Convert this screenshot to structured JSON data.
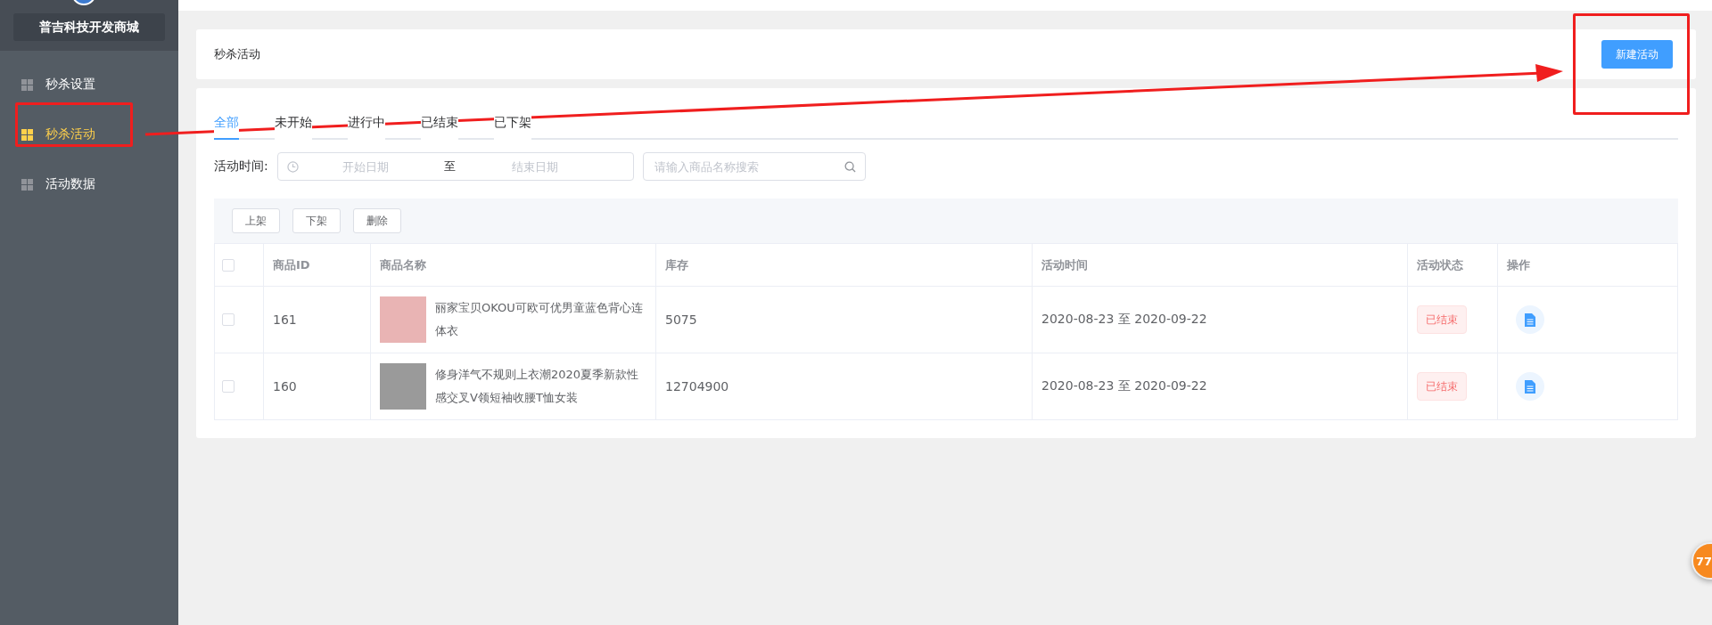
{
  "sidebar": {
    "store_name": "普吉科技开发商城",
    "items": [
      {
        "label": "秒杀设置",
        "selected": false
      },
      {
        "label": "秒杀活动",
        "selected": true
      },
      {
        "label": "活动数据",
        "selected": false
      }
    ]
  },
  "header": {
    "title": "秒杀活动",
    "button": "新建活动"
  },
  "tabs": [
    {
      "label": "全部",
      "selected": true
    },
    {
      "label": "未开始",
      "selected": false
    },
    {
      "label": "进行中",
      "selected": false
    },
    {
      "label": "已结束",
      "selected": false
    },
    {
      "label": "已下架",
      "selected": false
    }
  ],
  "filter": {
    "label": "活动时间:",
    "start_placeholder": "开始日期",
    "separator": "至",
    "end_placeholder": "结束日期",
    "search_placeholder": "请输入商品名称搜索"
  },
  "actions": [
    "上架",
    "下架",
    "删除"
  ],
  "table": {
    "header_checked": false,
    "columns": [
      "商品ID",
      "商品名称",
      "库存",
      "活动时间",
      "活动状态",
      "操作"
    ],
    "rows": [
      {
        "checked": false,
        "id": "161",
        "name": "丽家宝贝OKOU可欧可优男童蓝色背心连体衣",
        "stock": "5075",
        "time": "2020-08-23 至 2020-09-22",
        "status": "已结束"
      },
      {
        "checked": false,
        "id": "160",
        "name": "修身洋气不规则上衣潮2020夏季新款性感交叉V领短袖收腰T恤女装",
        "stock": "12704900",
        "time": "2020-08-23 至 2020-09-22",
        "status": "已结束"
      }
    ]
  },
  "floating_badge": "77"
}
